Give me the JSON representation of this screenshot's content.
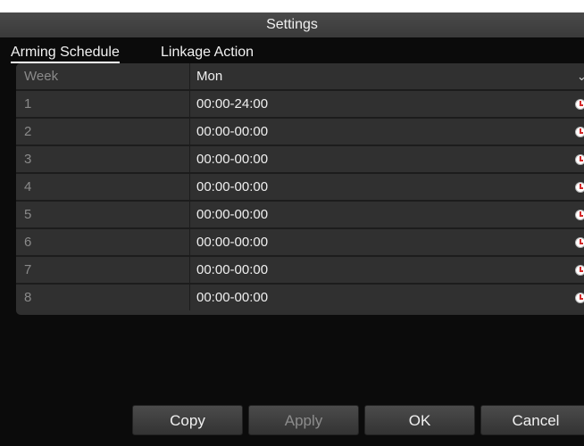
{
  "window": {
    "title": "Settings"
  },
  "tabs": [
    {
      "label": "Arming Schedule",
      "active": true
    },
    {
      "label": "Linkage Action",
      "active": false
    }
  ],
  "schedule": {
    "header": {
      "label": "Week",
      "value": "Mon",
      "icon": "chevron-down-icon"
    },
    "rows": [
      {
        "num": "1",
        "time": "00:00-24:00"
      },
      {
        "num": "2",
        "time": "00:00-00:00"
      },
      {
        "num": "3",
        "time": "00:00-00:00"
      },
      {
        "num": "4",
        "time": "00:00-00:00"
      },
      {
        "num": "5",
        "time": "00:00-00:00"
      },
      {
        "num": "6",
        "time": "00:00-00:00"
      },
      {
        "num": "7",
        "time": "00:00-00:00"
      },
      {
        "num": "8",
        "time": "00:00-00:00"
      }
    ],
    "row_icon": "clock-icon"
  },
  "buttons": {
    "copy": "Copy",
    "apply": "Apply",
    "ok": "OK",
    "cancel": "Cancel"
  },
  "colors": {
    "background": "#0b0b0b",
    "titlebar": "#3a3a3a",
    "panel": "#2f2f2f",
    "clock_hand": "#d42a2a"
  }
}
